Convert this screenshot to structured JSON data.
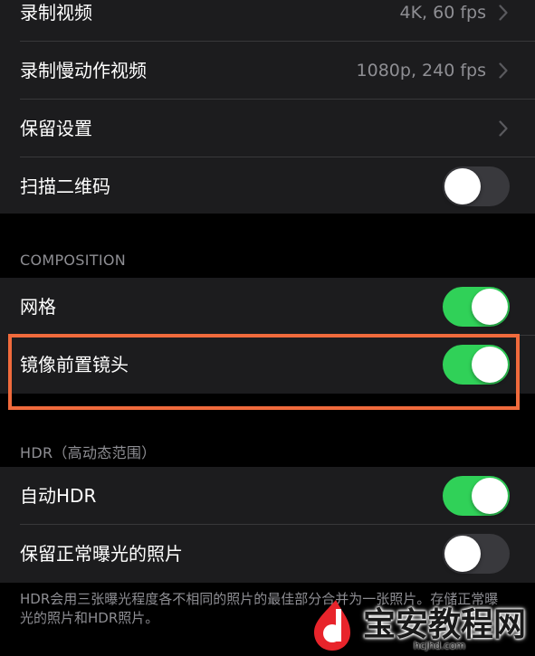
{
  "colors": {
    "background": "#000000",
    "cell": "#1c1c1e",
    "toggle_on": "#30d158",
    "toggle_off": "#39393d",
    "highlight": "#f06a3c",
    "secondary_text": "#8e8e93"
  },
  "camera_settings": {
    "rows": [
      {
        "label": "录制视频",
        "value": "4K, 60 fps",
        "icon": "chevron-right-icon"
      },
      {
        "label": "录制慢动作视频",
        "value": "1080p, 240 fps",
        "icon": "chevron-right-icon"
      },
      {
        "label": "保留设置",
        "icon": "chevron-right-icon"
      },
      {
        "label": "扫描二维码",
        "toggle": false
      }
    ]
  },
  "composition": {
    "header": "COMPOSITION",
    "rows": [
      {
        "label": "网格",
        "toggle": true
      },
      {
        "label": "镜像前置镜头",
        "toggle": true,
        "highlighted": true
      }
    ]
  },
  "hdr": {
    "header": "HDR（高动态范围）",
    "rows": [
      {
        "label": "自动HDR",
        "toggle": true
      },
      {
        "label": "保留正常曝光的照片",
        "toggle": false
      }
    ],
    "footer": "HDR会用三张曝光程度各不相同的照片的最佳部分合并为一张照片。存储正常曝光的照片和HDR照片。"
  },
  "watermark": {
    "text": "宝安教程网",
    "url": "hcjhd.com",
    "icon": "watermark-logo-icon"
  }
}
